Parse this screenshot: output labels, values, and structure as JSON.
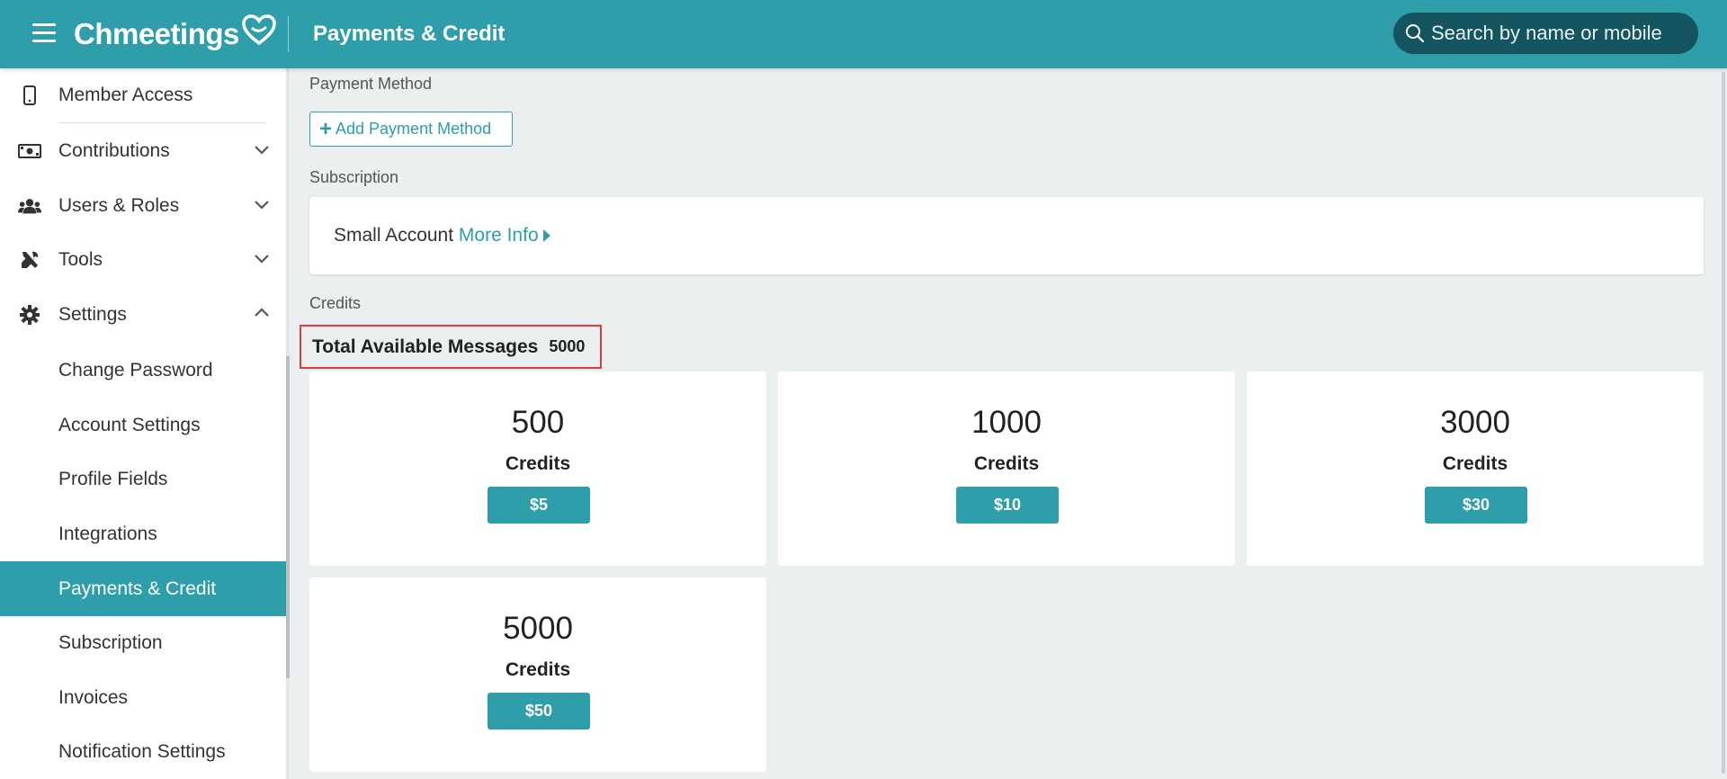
{
  "header": {
    "logo_text": "Chmeetings",
    "title": "Payments & Credit",
    "search_placeholder": "Search by name or mobile"
  },
  "sidebar": {
    "items": [
      {
        "label": "Member Access",
        "icon": "mobile-phone-icon"
      },
      {
        "label": "Contributions",
        "icon": "money-bill-icon",
        "expanded": false
      },
      {
        "label": "Users & Roles",
        "icon": "users-icon",
        "expanded": false
      },
      {
        "label": "Tools",
        "icon": "tools-icon",
        "expanded": false
      },
      {
        "label": "Settings",
        "icon": "gear-icon",
        "expanded": true
      }
    ],
    "settings_subitems": [
      "Change Password",
      "Account Settings",
      "Profile Fields",
      "Integrations",
      "Payments & Credit",
      "Subscription",
      "Invoices",
      "Notification Settings"
    ],
    "active_subitem": "Payments & Credit"
  },
  "main": {
    "payment_method_label": "Payment Method",
    "add_payment_method_label": "Add Payment Method",
    "subscription_label": "Subscription",
    "subscription_plan": "Small Account",
    "more_info_label": "More Info",
    "credits_label": "Credits",
    "total_messages_label": "Total Available Messages",
    "total_messages_value": "5000",
    "credit_packages": [
      {
        "amount": "500",
        "unit": "Credits",
        "price": "$5"
      },
      {
        "amount": "1000",
        "unit": "Credits",
        "price": "$10"
      },
      {
        "amount": "3000",
        "unit": "Credits",
        "price": "$30"
      },
      {
        "amount": "5000",
        "unit": "Credits",
        "price": "$50"
      }
    ]
  },
  "colors": {
    "brand": "#2e9eaa",
    "search_bg": "#14555f",
    "highlight_border": "#e03a3a",
    "page_bg": "#eceff0"
  }
}
